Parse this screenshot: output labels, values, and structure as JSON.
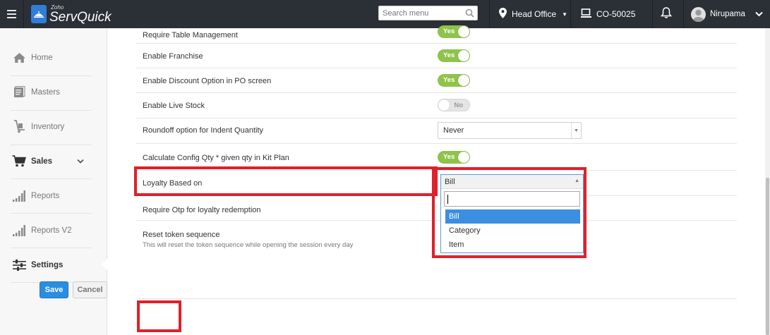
{
  "topbar": {
    "brand_small": "Zoho",
    "brand_main": "ServQuick",
    "search_placeholder": "Search menu",
    "location": "Head Office",
    "terminal": "CO-50025",
    "user": "Nirupama"
  },
  "sidebar": {
    "items": [
      {
        "label": "Home",
        "icon": "home-icon"
      },
      {
        "label": "Masters",
        "icon": "masters-icon"
      },
      {
        "label": "Inventory",
        "icon": "inventory-icon"
      },
      {
        "label": "Sales",
        "icon": "cart-icon"
      },
      {
        "label": "Reports",
        "icon": "bar-chart-icon"
      },
      {
        "label": "Reports V2",
        "icon": "bar-chart-icon"
      },
      {
        "label": "Settings",
        "icon": "sliders-icon"
      }
    ]
  },
  "settings": {
    "rows": [
      {
        "label": "Require Table Management",
        "value": "Yes"
      },
      {
        "label": "Enable Franchise",
        "value": "Yes"
      },
      {
        "label": "Enable Discount Option in PO screen",
        "value": "Yes"
      },
      {
        "label": "Enable Live Stock",
        "value": "No"
      },
      {
        "label": "Roundoff option for Indent Quantity",
        "value": "Never"
      },
      {
        "label": "Calculate Config Qty * given qty in Kit Plan",
        "value": "Yes"
      },
      {
        "label": "Loyalty Based on",
        "value": "Bill"
      },
      {
        "label": "Require Otp for loyalty redemption"
      },
      {
        "label": "Reset token sequence",
        "sublabel": "This will reset the token sequence while opening the session every day"
      }
    ],
    "loyalty_options": [
      "Bill",
      "Category",
      "Item"
    ]
  },
  "actions": {
    "save": "Save",
    "cancel": "Cancel"
  },
  "colors": {
    "topbar": "#2b2f36",
    "toggle_on": "#8fc34a",
    "primary_button": "#2a8ee0",
    "highlight": "#e0202a",
    "option_active": "#3b8ee0"
  }
}
